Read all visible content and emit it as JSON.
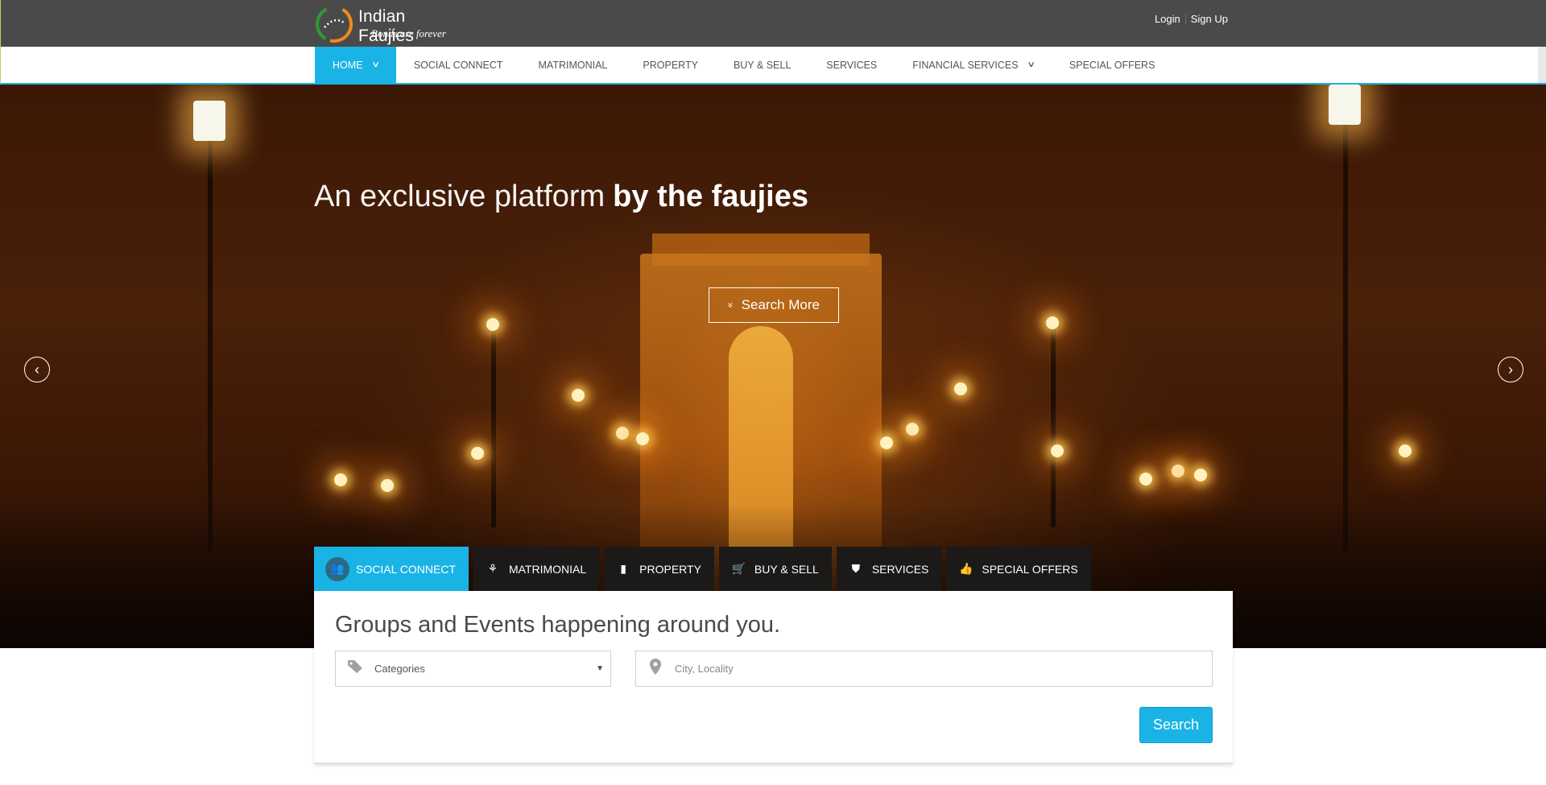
{
  "brand": {
    "name": "Indian Faujies",
    "tagline": "Bonds are forever"
  },
  "auth": {
    "login": "Login",
    "signup": "Sign Up"
  },
  "nav": {
    "items": [
      {
        "label": "HOME",
        "active": true,
        "has_dropdown": true
      },
      {
        "label": "SOCIAL CONNECT"
      },
      {
        "label": "MATRIMONIAL"
      },
      {
        "label": "PROPERTY"
      },
      {
        "label": "BUY & SELL"
      },
      {
        "label": "SERVICES"
      },
      {
        "label": "FINANCIAL SERVICES",
        "has_dropdown": true
      },
      {
        "label": "SPECIAL OFFERS"
      }
    ],
    "dropdown_glyph": "∨"
  },
  "hero": {
    "headline_light": "An exclusive platform",
    "headline_bold": "by the faujies",
    "cta_label": "Search More",
    "cta_icon": "double-chevron-down-icon",
    "prev_glyph": "‹",
    "next_glyph": "›"
  },
  "category_tabs": [
    {
      "label": "SOCIAL CONNECT",
      "icon": "users-icon",
      "glyph": "👥",
      "active": true
    },
    {
      "label": "MATRIMONIAL",
      "icon": "couple-icon",
      "glyph": "⚘"
    },
    {
      "label": "PROPERTY",
      "icon": "building-icon",
      "glyph": "▮"
    },
    {
      "label": "BUY & SELL",
      "icon": "cart-icon",
      "glyph": "🛒"
    },
    {
      "label": "SERVICES",
      "icon": "shield-icon",
      "glyph": "⛊"
    },
    {
      "label": "SPECIAL OFFERS",
      "icon": "thumbs-up-icon",
      "glyph": "👍"
    }
  ],
  "search_panel": {
    "title": "Groups and Events happening around you.",
    "categories_value": "Categories",
    "city_placeholder": "City, Locality",
    "search_label": "Search"
  },
  "colors": {
    "accent": "#1ab3e6",
    "topbar": "#4a4a4a",
    "tab_dark": "#1c1a19"
  }
}
